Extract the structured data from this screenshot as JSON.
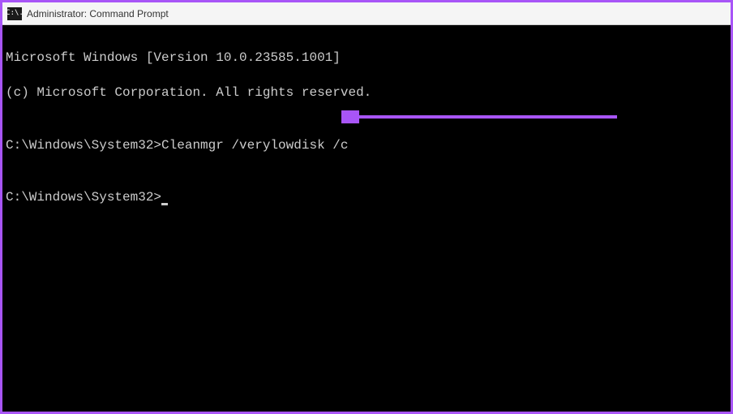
{
  "titlebar": {
    "icon_glyph": "C:\\.",
    "title": "Administrator: Command Prompt"
  },
  "terminal": {
    "line1": "Microsoft Windows [Version 10.0.23585.1001]",
    "line2": "(c) Microsoft Corporation. All rights reserved.",
    "blank1": "",
    "prompt1_path": "C:\\Windows\\System32>",
    "prompt1_cmd": "Cleanmgr /verylowdisk /c",
    "blank2": "",
    "prompt2_path": "C:\\Windows\\System32>"
  },
  "annotation": {
    "arrow_color": "#a855f7"
  }
}
